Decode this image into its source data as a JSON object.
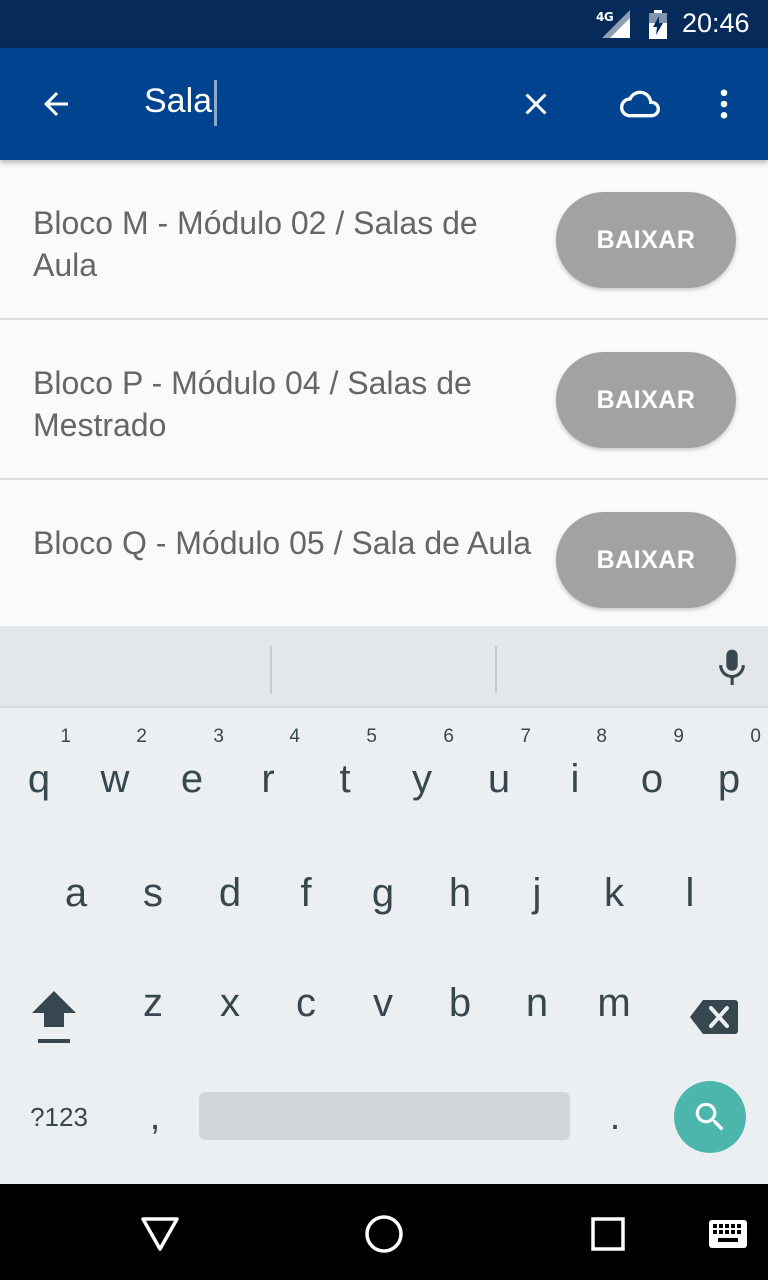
{
  "status_bar": {
    "network": "4G",
    "time": "20:46"
  },
  "app_bar": {
    "search_value": "Sala",
    "back_icon": "arrow-back-icon",
    "clear_icon": "close-icon",
    "cloud_icon": "cloud-icon",
    "more_icon": "more-vert-icon",
    "color": "#00438f"
  },
  "results": [
    {
      "title": "Bloco M - Módulo 02 / Salas de Aula",
      "button": "BAIXAR"
    },
    {
      "title": "Bloco P - Módulo 04 / Salas de Mestrado",
      "button": "BAIXAR"
    },
    {
      "title": "Bloco Q - Módulo 05 / Sala de Aula",
      "button": "BAIXAR"
    }
  ],
  "keyboard": {
    "row1": [
      {
        "char": "q",
        "hint": "1"
      },
      {
        "char": "w",
        "hint": "2"
      },
      {
        "char": "e",
        "hint": "3"
      },
      {
        "char": "r",
        "hint": "4"
      },
      {
        "char": "t",
        "hint": "5"
      },
      {
        "char": "y",
        "hint": "6"
      },
      {
        "char": "u",
        "hint": "7"
      },
      {
        "char": "i",
        "hint": "8"
      },
      {
        "char": "o",
        "hint": "9"
      },
      {
        "char": "p",
        "hint": "0"
      }
    ],
    "row2": [
      "a",
      "s",
      "d",
      "f",
      "g",
      "h",
      "j",
      "k",
      "l"
    ],
    "row3": [
      "z",
      "x",
      "c",
      "v",
      "b",
      "n",
      "m"
    ],
    "symbols_label": "?123",
    "comma": ",",
    "period": ".",
    "search_key_color": "#4db6ac"
  },
  "nav_bar": {
    "back_icon": "triangle-back-icon",
    "home_icon": "circle-home-icon",
    "recents_icon": "square-recents-icon",
    "keyboard_icon": "keyboard-icon"
  }
}
